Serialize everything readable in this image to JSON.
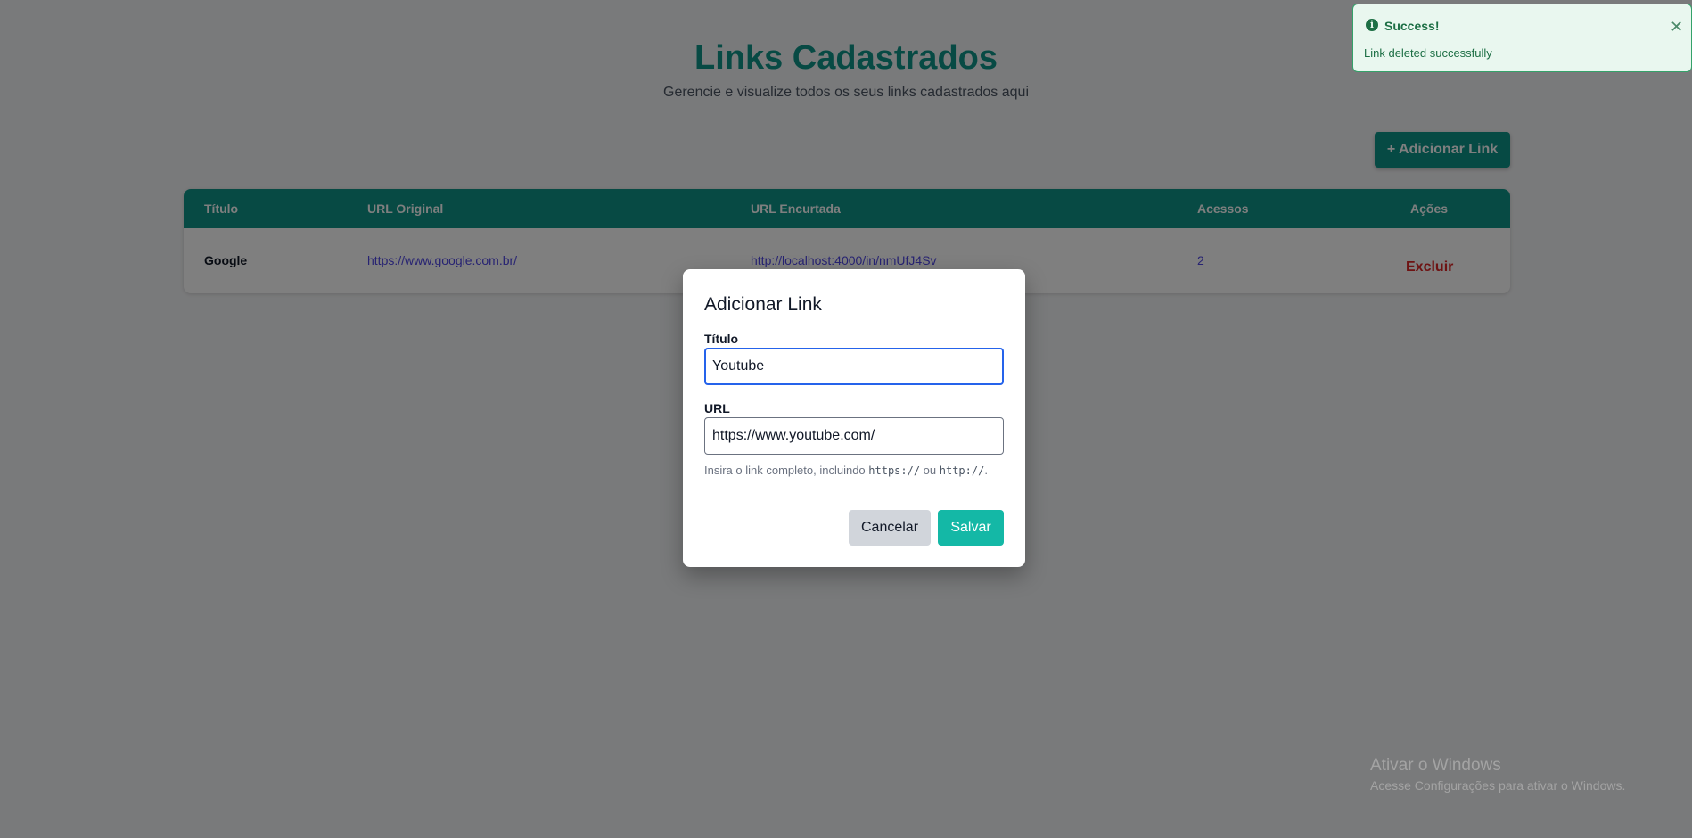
{
  "page": {
    "title": "Links Cadastrados",
    "subtitle": "Gerencie e visualize todos os seus links cadastrados aqui",
    "add_button_label": "+ Adicionar Link"
  },
  "table": {
    "headers": [
      "Título",
      "URL Original",
      "URL Encurtada",
      "Acessos",
      "Ações"
    ],
    "rows": [
      {
        "title": "Google",
        "original_url": "https://www.google.com.br/",
        "short_url": "http://localhost:4000/in/nmUfJ4Sv",
        "accesses": "2",
        "action_label": "Excluir"
      }
    ]
  },
  "toast": {
    "title": "Success!",
    "message": "Link deleted successfully",
    "icon": "info-icon"
  },
  "modal": {
    "title": "Adicionar Link",
    "title_field_label": "Título",
    "title_field_value": "Youtube",
    "url_field_label": "URL",
    "url_field_value": "https://www.youtube.com/",
    "help_prefix": "Insira o link completo, incluindo ",
    "help_code1": "https://",
    "help_middle": " ou ",
    "help_code2": "http://",
    "help_suffix": ".",
    "cancel_label": "Cancelar",
    "save_label": "Salvar"
  },
  "watermark": {
    "title": "Ativar o Windows",
    "subtitle": "Acesse Configurações para ativar o Windows."
  },
  "colors": {
    "primary": "#0f9488",
    "save_button": "#14b8a6",
    "danger": "#dc2626",
    "link": "#4f46e5",
    "toast_bg": "#e9f7ef"
  }
}
